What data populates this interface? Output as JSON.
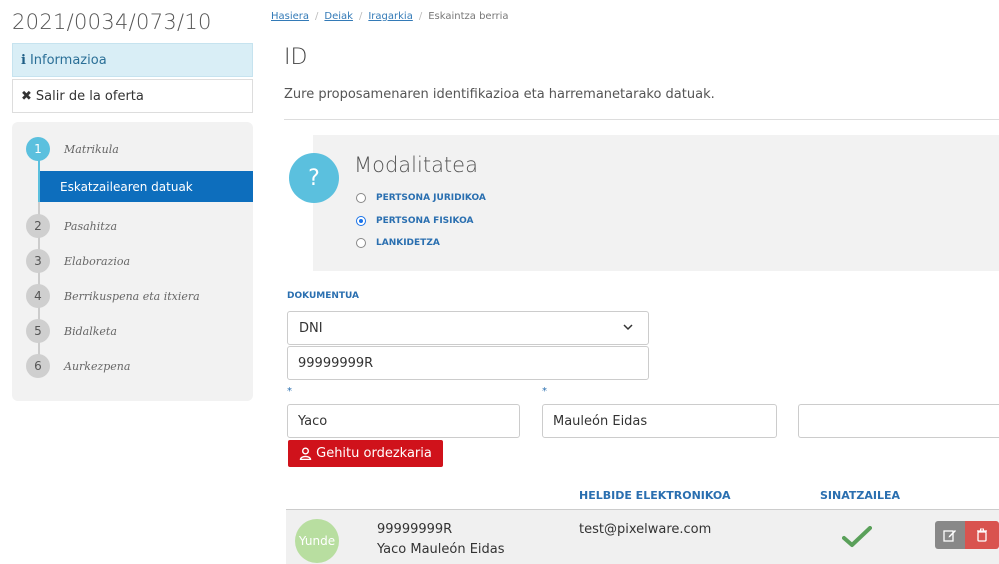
{
  "file_id": "2021/0034/073/10",
  "sidebar": {
    "info_icon": "i",
    "info_label": "Informazioa",
    "exit_icon": "✖",
    "exit_label": "Salir de la oferta",
    "steps": [
      {
        "num": "1",
        "label": "Matrikula",
        "active": true
      },
      {
        "num": "2",
        "label": "Pasahitza"
      },
      {
        "num": "3",
        "label": "Elaborazioa"
      },
      {
        "num": "4",
        "label": "Berrikuspena eta itxiera"
      },
      {
        "num": "5",
        "label": "Bidalketa"
      },
      {
        "num": "6",
        "label": "Aurkezpena"
      }
    ],
    "active_substep": "Eskatzailearen datuak"
  },
  "breadcrumb": {
    "items": [
      "Hasiera",
      "Deiak",
      "Iragarkia",
      "Eskaintza berria"
    ],
    "separator": "/"
  },
  "page": {
    "title": "ID",
    "subtitle": "Zure proposamenaren identifikazioa eta harremanetarako datuak."
  },
  "modalitatea": {
    "icon": "?",
    "title": "Modalitatea",
    "options": [
      {
        "label": "PERTSONA JURIDIKOA",
        "checked": false
      },
      {
        "label": "PERTSONA FISIKOA",
        "checked": true
      },
      {
        "label": "LANKIDETZA",
        "checked": false
      }
    ]
  },
  "dokumentua": {
    "label": "DOKUMENTUA",
    "type_value": "DNI",
    "number_value": "99999999R"
  },
  "name_fields": {
    "required_mark": "*",
    "first_name": "Yaco",
    "last_name": "Mauleón Eidas",
    "third": ""
  },
  "add_rep_button": "Gehitu ordezkaria",
  "table": {
    "headers": [
      "HELBIDE ELEKTRONIKOA",
      "SINATZAILEA"
    ],
    "row": {
      "avatar_text": "Yunde",
      "doc": "99999999R",
      "name": "Yaco Mauleón Eidas",
      "email": "test@pixelware.com",
      "signer_icon": "✔"
    }
  },
  "colors": {
    "accent": "#5bc0de",
    "primary": "#0d6ebd",
    "danger": "#d0121b",
    "label_blue": "#2a6fb0"
  }
}
